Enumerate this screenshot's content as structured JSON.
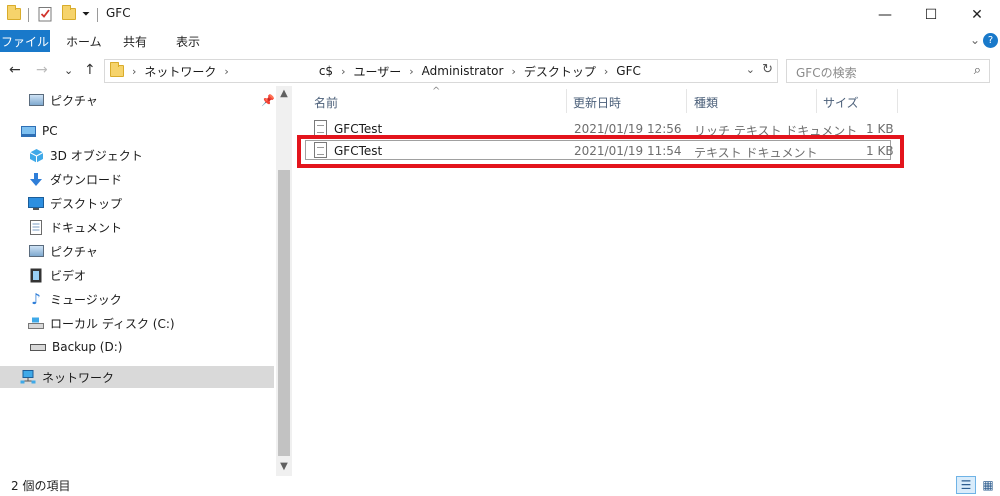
{
  "window": {
    "title": "GFC",
    "controls": {
      "minimize": "—",
      "maximize": "☐",
      "close": "✕"
    }
  },
  "quick_access": {
    "dropdown": "⏷"
  },
  "ribbon": {
    "tabs": [
      {
        "label": "ファイル",
        "active": true
      },
      {
        "label": "ホーム"
      },
      {
        "label": "共有"
      },
      {
        "label": "表示"
      }
    ],
    "expand": "⌄",
    "help": "?"
  },
  "address": {
    "back": "←",
    "forward": "→",
    "recent": "⌄",
    "up": "↑",
    "breadcrumb": [
      "ネットワーク",
      "c$",
      "ユーザー",
      "Administrator",
      "デスクトップ",
      "GFC"
    ],
    "crumb_separator": "›",
    "dropdown": "⌄",
    "refresh": "↻"
  },
  "search": {
    "placeholder": "GFCの検索",
    "icon": "⌕"
  },
  "nav": {
    "pin": "📌",
    "items": [
      {
        "label": "ピクチャ",
        "icon": "pictures-icon",
        "indent": 1,
        "pinned": true
      },
      {
        "label": "PC",
        "icon": "pc-icon",
        "indent": 0
      },
      {
        "label": "3D オブジェクト",
        "icon": "3d-objects-icon",
        "indent": 1
      },
      {
        "label": "ダウンロード",
        "icon": "download-icon",
        "indent": 1
      },
      {
        "label": "デスクトップ",
        "icon": "desktop-icon",
        "indent": 1
      },
      {
        "label": "ドキュメント",
        "icon": "documents-icon",
        "indent": 1
      },
      {
        "label": "ピクチャ",
        "icon": "pictures-icon",
        "indent": 1
      },
      {
        "label": "ビデオ",
        "icon": "video-icon",
        "indent": 1
      },
      {
        "label": "ミュージック",
        "icon": "music-icon",
        "indent": 1
      },
      {
        "label": "ローカル ディスク (C:)",
        "icon": "local-disk-icon",
        "indent": 1
      },
      {
        "label": "Backup (D:)",
        "icon": "drive-icon",
        "indent": 1
      },
      {
        "label": "ネットワーク",
        "icon": "network-icon",
        "indent": 0,
        "selected": true
      }
    ]
  },
  "scrollbar": {
    "up": "▲",
    "down": "▼"
  },
  "files": {
    "sort_indicator": "^",
    "columns": [
      "名前",
      "更新日時",
      "種類",
      "サイズ"
    ],
    "rows": [
      {
        "name": "GFCTest",
        "modified": "2021/01/19 12:56",
        "type": "リッチ テキスト ドキュメント",
        "size": "1 KB",
        "icon": "rich-text-document-icon"
      },
      {
        "name": "GFCTest",
        "modified": "2021/01/19 11:54",
        "type": "テキスト ドキュメント",
        "size": "1 KB",
        "icon": "text-document-icon",
        "focused": true
      }
    ]
  },
  "annotation": {
    "highlight_color": "#e3141c"
  },
  "status": {
    "item_count": "2 個の項目",
    "details_view": "☰",
    "large_icons_view": "▦"
  },
  "colors": {
    "accent": "#1979ca",
    "selection": "#d9d9d9"
  }
}
